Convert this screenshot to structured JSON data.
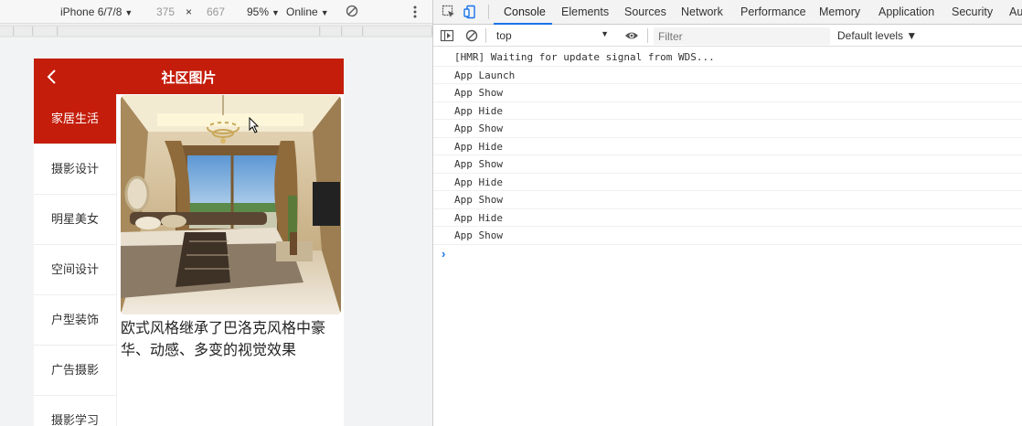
{
  "device_toolbar": {
    "device": "iPhone 6/7/8",
    "width": "375",
    "times": "×",
    "height": "667",
    "zoom": "95%",
    "network": "Online",
    "caret": "▼"
  },
  "app": {
    "title": "社区图片",
    "categories": [
      "家居生活",
      "摄影设计",
      "明星美女",
      "空间设计",
      "户型装饰",
      "广告摄影",
      "摄影学习"
    ],
    "active_category": 0,
    "caption": "欧式风格继承了巴洛克风格中豪华、动感、多变的视觉效果",
    "brand_color": "#c41d0b"
  },
  "devtools": {
    "tabs": [
      "Console",
      "Elements",
      "Sources",
      "Network",
      "Performance",
      "Memory",
      "Application",
      "Security",
      "Au"
    ],
    "active_tab": "Console",
    "context": "top",
    "filter_placeholder": "Filter",
    "levels": "Default levels ▼",
    "log": [
      "[HMR] Waiting for update signal from WDS...",
      "App Launch",
      "App Show",
      "App Hide",
      "App Show",
      "App Hide",
      "App Show",
      "App Hide",
      "App Show",
      "App Hide",
      "App Show"
    ],
    "prompt": "›",
    "accent_color": "#1a73e8"
  }
}
